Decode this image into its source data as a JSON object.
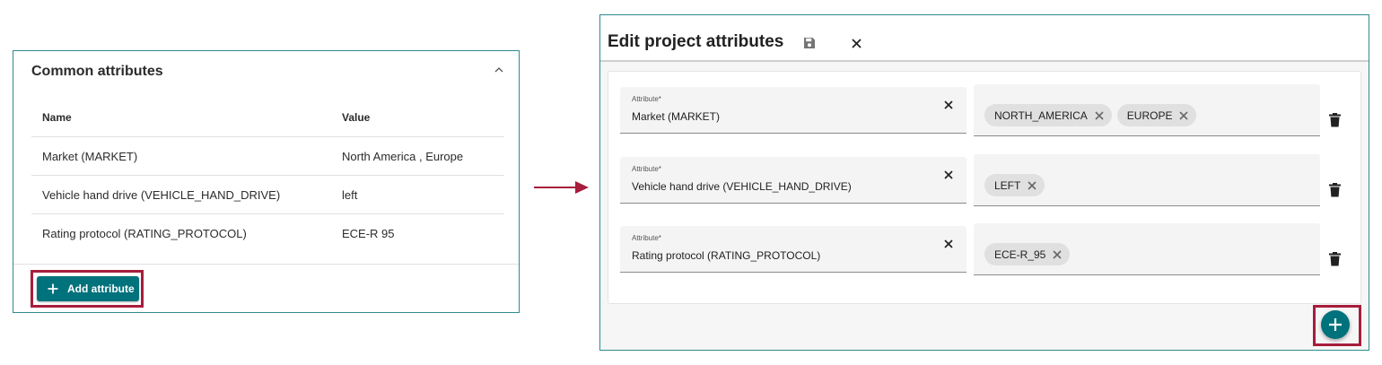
{
  "common_attributes": {
    "title": "Common attributes",
    "columns": {
      "name": "Name",
      "value": "Value"
    },
    "rows": [
      {
        "name": "Market (MARKET)",
        "value": "North America , Europe"
      },
      {
        "name": "Vehicle hand drive (VEHICLE_HAND_DRIVE)",
        "value": "left"
      },
      {
        "name": "Rating protocol (RATING_PROTOCOL)",
        "value": "ECE-R 95"
      }
    ],
    "add_button_label": "Add attribute"
  },
  "edit_dialog": {
    "title": "Edit project attributes",
    "attribute_rows": [
      {
        "label": "Attribute*",
        "value": "Market (MARKET)",
        "chips": [
          "NORTH_AMERICA",
          "EUROPE"
        ]
      },
      {
        "label": "Attribute*",
        "value": "Vehicle hand drive (VEHICLE_HAND_DRIVE)",
        "chips": [
          "LEFT"
        ]
      },
      {
        "label": "Attribute*",
        "value": "Rating protocol (RATING_PROTOCOL)",
        "chips": [
          "ECE-R_95"
        ]
      }
    ]
  },
  "icons": {
    "collapse": "chevron-up-icon",
    "add": "plus-icon",
    "arrow": "arrow-right-icon",
    "save": "save-icon",
    "close": "close-icon",
    "clear": "close-icon",
    "chip_remove": "close-icon",
    "delete": "trash-icon",
    "fab": "plus-icon"
  },
  "colors": {
    "accent": "#00727c",
    "card_border": "#2e8a8f",
    "highlight": "#a71d3c",
    "chip_bg": "#e0e0e0"
  }
}
